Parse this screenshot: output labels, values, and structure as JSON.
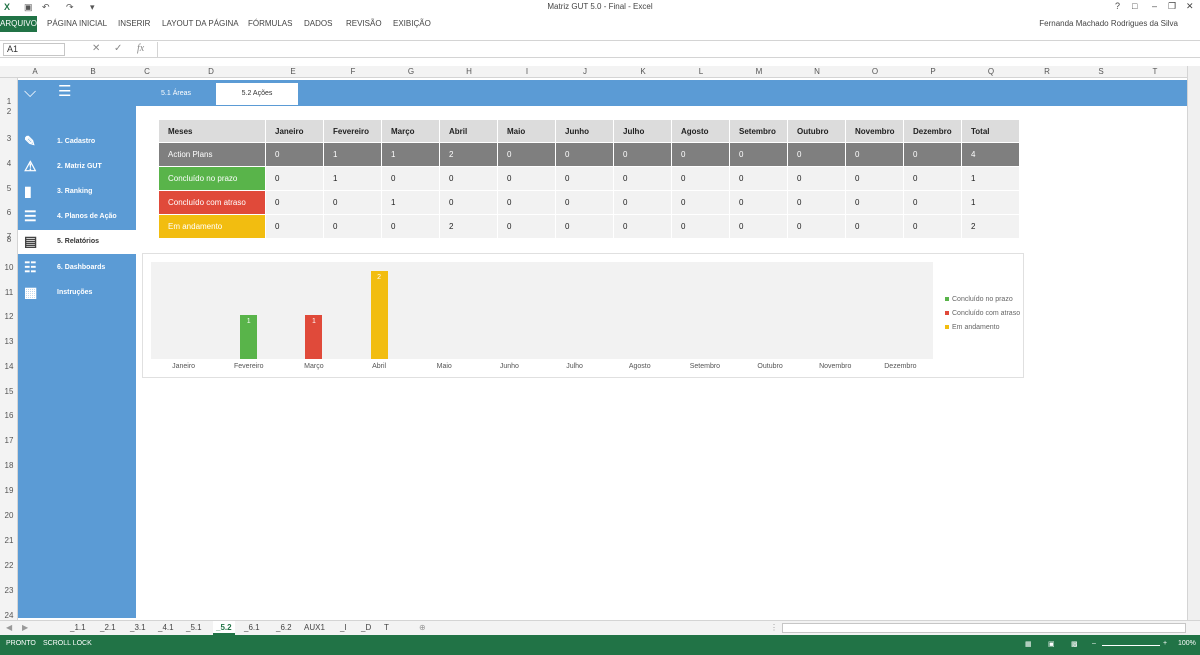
{
  "window": {
    "title": "Matriz GUT 5.0 - Final - Excel",
    "user": "Fernanda Machado Rodrigues da Silva"
  },
  "ribbon": {
    "tabs": [
      "ARQUIVO",
      "PÁGINA INICIAL",
      "INSERIR",
      "LAYOUT DA PÁGINA",
      "FÓRMULAS",
      "DADOS",
      "REVISÃO",
      "EXIBIÇÃO"
    ]
  },
  "formula_bar": {
    "name_box": "A1",
    "fx": "fx",
    "formula": ""
  },
  "columns": [
    "A",
    "B",
    "C",
    "D",
    "E",
    "F",
    "G",
    "H",
    "I",
    "J",
    "K",
    "L",
    "M",
    "N",
    "O",
    "P",
    "Q",
    "R",
    "S",
    "T"
  ],
  "rows": [
    "1",
    "2",
    "3",
    "4",
    "5",
    "6",
    "7",
    "8",
    "10",
    "11",
    "12",
    "13",
    "14",
    "15",
    "16",
    "17",
    "18",
    "19",
    "20",
    "21",
    "22",
    "23",
    "24"
  ],
  "subtabs": [
    "5.1 Áreas",
    "5.2 Ações"
  ],
  "nav": [
    {
      "label": "1. Cadastro",
      "icon": "form-icon"
    },
    {
      "label": "2. Matriz GUT",
      "icon": "alarm-icon"
    },
    {
      "label": "3. Ranking",
      "icon": "bar-chart-icon"
    },
    {
      "label": "4. Planos de Ação",
      "icon": "checklist-icon"
    },
    {
      "label": "5. Relatórios",
      "icon": "report-icon"
    },
    {
      "label": "6. Dashboards",
      "icon": "dashboard-icon"
    },
    {
      "label": "Instruções",
      "icon": "instructions-icon"
    }
  ],
  "table": {
    "headers": [
      "Meses",
      "Janeiro",
      "Fevereiro",
      "Março",
      "Abril",
      "Maio",
      "Junho",
      "Julho",
      "Agosto",
      "Setembro",
      "Outubro",
      "Novembro",
      "Dezembro",
      "Total"
    ],
    "rows": [
      {
        "label": "Action Plans",
        "values": [
          "0",
          "1",
          "1",
          "2",
          "0",
          "0",
          "0",
          "0",
          "0",
          "0",
          "0",
          "0",
          "4"
        ]
      },
      {
        "label": "Concluído no prazo",
        "values": [
          "0",
          "1",
          "0",
          "0",
          "0",
          "0",
          "0",
          "0",
          "0",
          "0",
          "0",
          "0",
          "1"
        ]
      },
      {
        "label": "Concluído com atraso",
        "values": [
          "0",
          "0",
          "1",
          "0",
          "0",
          "0",
          "0",
          "0",
          "0",
          "0",
          "0",
          "0",
          "1"
        ]
      },
      {
        "label": "Em andamento",
        "values": [
          "0",
          "0",
          "0",
          "2",
          "0",
          "0",
          "0",
          "0",
          "0",
          "0",
          "0",
          "0",
          "2"
        ]
      }
    ]
  },
  "chart_data": {
    "type": "bar",
    "categories": [
      "Janeiro",
      "Fevereiro",
      "Março",
      "Abril",
      "Maio",
      "Junho",
      "Julho",
      "Agosto",
      "Setembro",
      "Outubro",
      "Novembro",
      "Dezembro"
    ],
    "series": [
      {
        "name": "Concluído no prazo",
        "color": "#59b44a",
        "values": [
          0,
          1,
          0,
          0,
          0,
          0,
          0,
          0,
          0,
          0,
          0,
          0
        ]
      },
      {
        "name": "Concluído com atraso",
        "color": "#e04a3a",
        "values": [
          0,
          0,
          1,
          0,
          0,
          0,
          0,
          0,
          0,
          0,
          0,
          0
        ]
      },
      {
        "name": "Em andamento",
        "color": "#f2bd10",
        "values": [
          0,
          0,
          0,
          2,
          0,
          0,
          0,
          0,
          0,
          0,
          0,
          0
        ]
      }
    ],
    "ylim": [
      0,
      2.2
    ],
    "legend": "right"
  },
  "sheets": [
    "_1.1",
    "_2.1",
    "_3.1",
    "_4.1",
    "_5.1",
    "_5.2",
    "_6.1",
    "_6.2",
    "AUX1",
    "_I",
    "_D",
    "T"
  ],
  "active_sheet": "_5.2",
  "status": {
    "ready": "PRONTO",
    "scroll": "SCROLL LOCK",
    "zoom": "100%"
  }
}
